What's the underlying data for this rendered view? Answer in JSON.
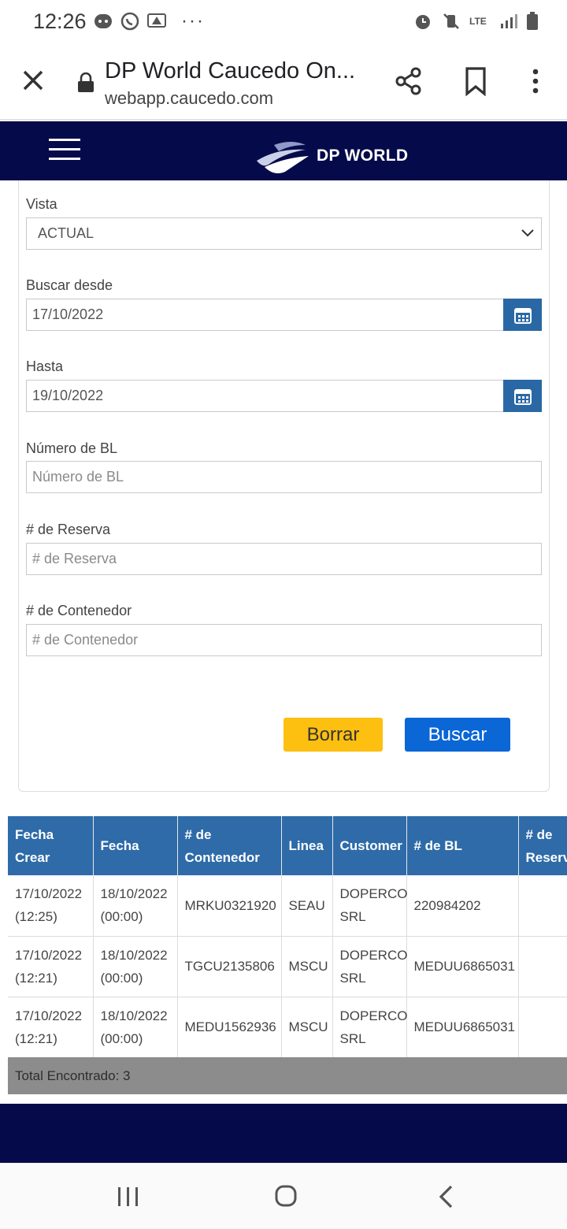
{
  "status_bar": {
    "time": "12:26",
    "left_icons": [
      "messenger-icon",
      "whatsapp-icon",
      "alert-icon"
    ],
    "more": "···",
    "right_icons": [
      "alarm-icon",
      "vibrate-mute-icon",
      "lte-icon",
      "signal-icon",
      "battery-icon"
    ],
    "network": "LTE"
  },
  "browser": {
    "title": "DP World Caucedo On...",
    "url": "webapp.caucedo.com"
  },
  "header": {
    "brand": "DP WORLD"
  },
  "form": {
    "vista_label": "Vista",
    "vista_value": "ACTUAL",
    "desde_label": "Buscar desde",
    "desde_value": "17/10/2022",
    "hasta_label": "Hasta",
    "hasta_value": "19/10/2022",
    "bl_label": "Número de BL",
    "bl_placeholder": "Número de BL",
    "reserva_label": "# de Reserva",
    "reserva_placeholder": "# de Reserva",
    "contenedor_label": "# de Contenedor",
    "contenedor_placeholder": "# de Contenedor",
    "clear_label": "Borrar",
    "search_label": "Buscar"
  },
  "results": {
    "headers": [
      "Fecha Crear",
      "Fecha",
      "# de Contenedor",
      "Linea",
      "Customer",
      "# de BL",
      "# de Reserva"
    ],
    "rows": [
      [
        "17/10/2022 (12:25)",
        "18/10/2022 (00:00)",
        "MRKU0321920",
        "SEAU",
        "DOPERCO SRL",
        "220984202",
        ""
      ],
      [
        "17/10/2022 (12:21)",
        "18/10/2022 (00:00)",
        "TGCU2135806",
        "MSCU",
        "DOPERCO SRL",
        "MEDUU6865031",
        ""
      ],
      [
        "17/10/2022 (12:21)",
        "18/10/2022 (00:00)",
        "MEDU1562936",
        "MSCU",
        "DOPERCO SRL",
        "MEDUU6865031",
        ""
      ]
    ],
    "total": "Total Encontrado: 3"
  },
  "colors": {
    "navy": "#050a4a",
    "table_header": "#2e6ba8",
    "calendar_button": "#2a68a5",
    "borrar": "#fdbf10",
    "buscar": "#0b66d6"
  }
}
